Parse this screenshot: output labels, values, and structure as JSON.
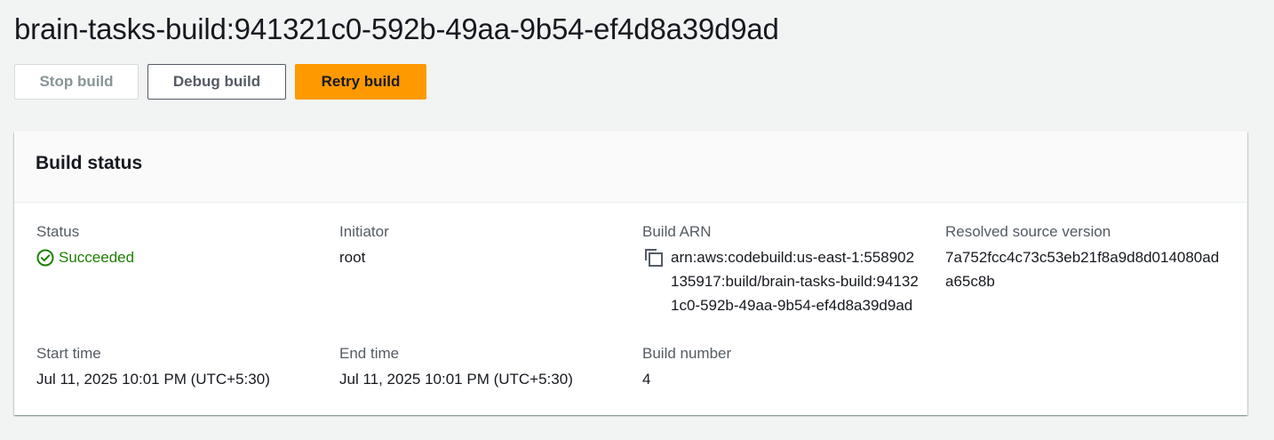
{
  "header": {
    "title": "brain-tasks-build:941321c0-592b-49aa-9b54-ef4d8a39d9ad"
  },
  "toolbar": {
    "stop_label": "Stop build",
    "debug_label": "Debug build",
    "retry_label": "Retry build"
  },
  "build_status": {
    "title": "Build status",
    "status": {
      "label": "Status",
      "value": "Succeeded",
      "icon": "check-circle-icon",
      "color": "#1d8102"
    },
    "initiator": {
      "label": "Initiator",
      "value": "root"
    },
    "build_arn": {
      "label": "Build ARN",
      "value": "arn:aws:codebuild:us-east-1:558902135917:build/brain-tasks-build:941321c0-592b-49aa-9b54-ef4d8a39d9ad",
      "icon": "copy-icon"
    },
    "resolved_source_version": {
      "label": "Resolved source version",
      "value": "7a752fcc4c73c53eb21f8a9d8d014080ada65c8b"
    },
    "start_time": {
      "label": "Start time",
      "value": "Jul 11, 2025 10:01 PM (UTC+5:30)"
    },
    "end_time": {
      "label": "End time",
      "value": "Jul 11, 2025 10:01 PM (UTC+5:30)"
    },
    "build_number": {
      "label": "Build number",
      "value": "4"
    }
  },
  "colors": {
    "accent": "#ff9900",
    "success": "#1d8102",
    "background": "#f2f3f3"
  }
}
